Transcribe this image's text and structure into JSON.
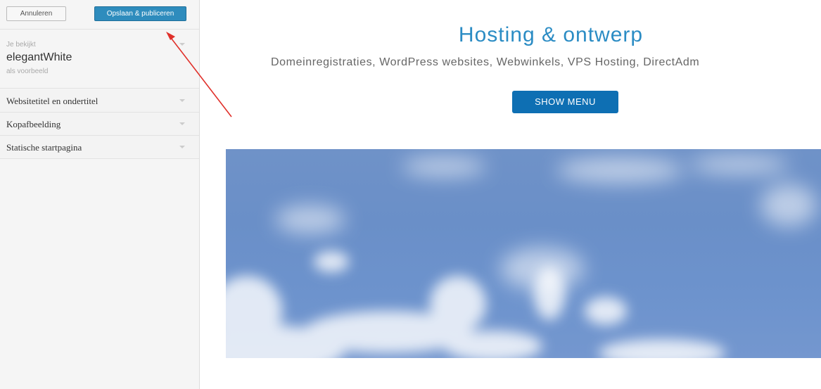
{
  "sidebar": {
    "cancel_label": "Annuleren",
    "publish_label": "Opslaan & publiceren",
    "theme": {
      "viewing_label": "Je bekijkt",
      "name": "elegantWhite",
      "preview_label": "als voorbeeld"
    },
    "sections": [
      {
        "label": "Websitetitel en ondertitel"
      },
      {
        "label": "Kopafbeelding"
      },
      {
        "label": "Statische startpagina"
      }
    ]
  },
  "preview": {
    "site_title": "Hosting & ontwerp",
    "site_tagline": "Domeinregistraties, WordPress websites, Webwinkels, VPS Hosting, DirectAdm",
    "menu_button_label": "SHOW MENU"
  },
  "colors": {
    "publish_button": "#2e8cbd",
    "title": "#2b8cc4",
    "menu_button": "#0e6fb3",
    "annotation_arrow": "#e0302a"
  },
  "icons": {
    "section_toggle": "chevron-down-icon",
    "annotation": "red-arrow-annotation"
  }
}
